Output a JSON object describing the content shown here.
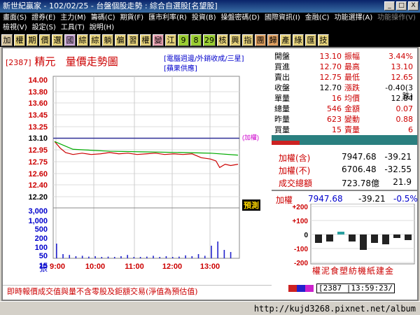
{
  "window": {
    "title": "新世紀贏家 - 102/02/25 - 台盤個股走勢 : 綜合自選股[名望股]",
    "buttons": [
      "_",
      "□",
      "X"
    ]
  },
  "menu1": [
    "畫面(S)",
    "證券(E)",
    "主力(M)",
    "籌碼(C)",
    "期貨(F)",
    "匯市利率(R)",
    "投資(B)",
    "操盤密碼(D)",
    "國際資訊(I)",
    "金融(C)",
    "功能選擇(A)"
  ],
  "menu1_dim": "功能操作(V)",
  "menu2": [
    "檢視(V)",
    "設定(S)",
    "工具(T)",
    "說明(H)"
  ],
  "toolbar": [
    "加",
    "權",
    "期",
    "價",
    "選",
    "國",
    "綜",
    "綜",
    "躺",
    "偏",
    "習",
    "權",
    "變",
    "江",
    "9",
    "8",
    "29",
    "核",
    "興",
    "指",
    "團",
    "歸",
    "產",
    "綠",
    "匯",
    "技"
  ],
  "stock": {
    "code": "[2387]",
    "name": "精元",
    "chart_title": "量價走勢圖",
    "tags1": "[電腦週邊/外銷收成/三星]",
    "tags2": "[蘋果供應]",
    "flag": "(加權)",
    "label_mid": "預測"
  },
  "quote": {
    "rows": [
      {
        "l1": "開盤",
        "v1": "13.10",
        "c1": "red",
        "l2": "振幅",
        "v2": "3.44%",
        "c2": "red"
      },
      {
        "l1": "買進",
        "v1": "12.70",
        "c1": "red",
        "l2": "最高",
        "v2": "13.10",
        "c2": "red"
      },
      {
        "l1": "賣出",
        "v1": "12.75",
        "c1": "red",
        "l2": "最低",
        "v2": "12.65",
        "c2": "red"
      },
      {
        "l1": "收盤",
        "v1": "12.70",
        "c1": "blk",
        "l2": "漲跌",
        "v2": "-0.40(3跌)",
        "c2": "blk"
      },
      {
        "l1": "單量",
        "v1": "16",
        "c1": "red",
        "l2": "均價",
        "v2": "12.84",
        "c2": "blk"
      },
      {
        "l1": "總量",
        "v1": "546",
        "c1": "red",
        "l2": "金額",
        "v2": "0.07",
        "c2": "red"
      },
      {
        "l1": "昨量",
        "v1": "623",
        "c1": "red",
        "l2": "變動",
        "v2": "0.88",
        "c2": "red"
      },
      {
        "l1": "買量",
        "v1": "15",
        "c1": "red",
        "l2": "賣量",
        "v2": "6",
        "c2": "red"
      }
    ]
  },
  "index": {
    "rows": [
      {
        "label": "加權(含)",
        "value": "7947.68",
        "chg": "-39.21"
      },
      {
        "label": "加權(不)",
        "value": "6706.48",
        "chg": "-32.55"
      },
      {
        "label": "成交總額",
        "value": "723.78億",
        "chg": "21.9"
      }
    ]
  },
  "mini": {
    "label": "加權",
    "value": "7947.68",
    "chg": "-39.21",
    "pct": "-0.5%",
    "yticks": [
      "+200",
      "+100",
      "0",
      "-100",
      "-200"
    ],
    "sectors": "權泥食塑紡機紙建金"
  },
  "banner": "即時報價成交值與量不含零股及鉅額交易(淨值為預估值)",
  "time": "[2387    |13:59:23/",
  "url": "http://kujd3268.pixnet.net/album",
  "chart_data": {
    "type": "line",
    "price_ticks": [
      "14.00",
      "13.80",
      "13.60",
      "13.45",
      "13.25",
      "13.10",
      "12.95",
      "12.75",
      "12.60",
      "12.40",
      "12.20"
    ],
    "volume_ticks": [
      "3,000",
      "1,000",
      "500",
      "200",
      "100",
      "50",
      "15"
    ],
    "volume_unit": "張",
    "x_ticks": [
      "9:00",
      "10:00",
      "11:00",
      "12:00",
      "13:00"
    ],
    "ref_price": 13.1,
    "colors": {
      "price": "#cc0000",
      "avg": "#00aa00",
      "ref": "#333399"
    },
    "ylim": [
      12.2,
      14.0
    ],
    "price_series": [
      [
        0,
        13.05
      ],
      [
        0.03,
        12.95
      ],
      [
        0.06,
        12.88
      ],
      [
        0.1,
        12.85
      ],
      [
        0.15,
        12.87
      ],
      [
        0.2,
        12.85
      ],
      [
        0.25,
        12.86
      ],
      [
        0.3,
        12.88
      ],
      [
        0.35,
        12.86
      ],
      [
        0.4,
        12.87
      ],
      [
        0.45,
        12.85
      ],
      [
        0.5,
        12.86
      ],
      [
        0.55,
        12.87
      ],
      [
        0.6,
        12.85
      ],
      [
        0.65,
        12.86
      ],
      [
        0.7,
        12.85
      ],
      [
        0.75,
        12.86
      ],
      [
        0.8,
        12.8
      ],
      [
        0.85,
        12.78
      ],
      [
        0.88,
        12.75
      ],
      [
        0.9,
        12.65
      ],
      [
        0.93,
        12.7
      ],
      [
        0.96,
        12.68
      ],
      [
        1.0,
        12.7
      ]
    ],
    "avg_series": [
      [
        0,
        13.05
      ],
      [
        0.1,
        12.93
      ],
      [
        0.3,
        12.9
      ],
      [
        0.5,
        12.89
      ],
      [
        0.7,
        12.88
      ],
      [
        0.85,
        12.87
      ],
      [
        1.0,
        12.84
      ]
    ],
    "volumes": [
      0.35,
      0.1,
      0.08,
      0.05,
      0.06,
      0.04,
      0.05,
      0.03,
      0.04,
      0.02,
      0.05,
      0.08,
      0.03,
      0.02,
      0.04,
      0.06,
      0.02,
      0.05,
      0.03,
      0.04,
      0.07,
      0.05,
      0.1,
      0.06,
      0.3,
      0.4,
      0.2,
      0.15
    ]
  },
  "mini_bars": [
    -0.12,
    -0.1,
    0.04,
    -0.1,
    -0.22,
    -0.12,
    -0.14,
    -0.05,
    -0.08
  ]
}
